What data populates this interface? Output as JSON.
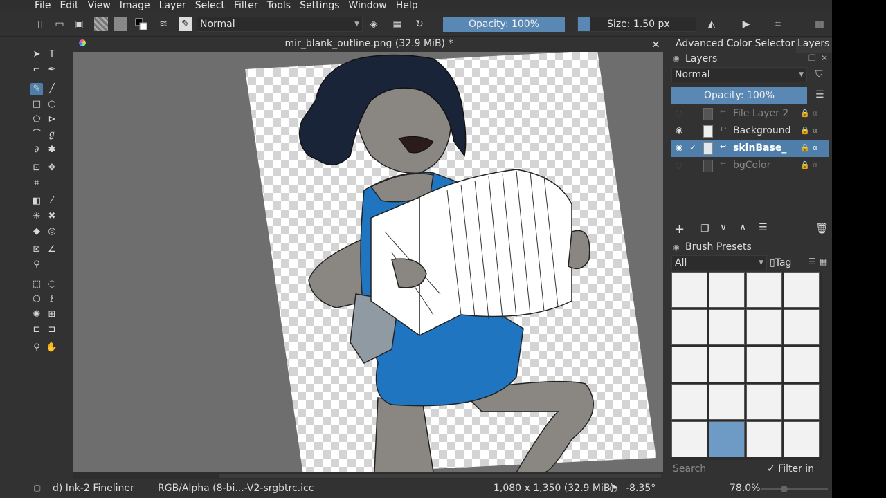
{
  "menu": [
    "File",
    "Edit",
    "View",
    "Image",
    "Layer",
    "Select",
    "Filter",
    "Tools",
    "Settings",
    "Window",
    "Help"
  ],
  "toolbar": {
    "blend_mode": "Normal",
    "opacity": "Opacity: 100%",
    "size": "Size: 1.50 px"
  },
  "document": {
    "title": "mir_blank_outline.png (32.9 MiB) *",
    "close": "×"
  },
  "docker": {
    "tabs": [
      "Advanced Color Selector",
      "Layers"
    ],
    "layers_title": "Layers",
    "blend_mode": "Normal",
    "opacity": "Opacity:  100%",
    "layers": [
      {
        "name": "File Layer 2",
        "visible": false,
        "selected": false
      },
      {
        "name": "Background",
        "visible": true,
        "selected": false
      },
      {
        "name": "skinBase_",
        "visible": true,
        "selected": true
      },
      {
        "name": "bgColor",
        "visible": false,
        "selected": false
      }
    ],
    "brush_presets_title": "Brush Presets",
    "preset_filter": "All",
    "tag_label": "Tag",
    "search_placeholder": "Search",
    "filter_in_tag": "Filter in Tag"
  },
  "status": {
    "brush": "d) Ink-2 Fineliner",
    "color_profile": "RGB/Alpha (8-bi...-V2-srgbtrc.icc",
    "dimensions": "1,080 x 1,350 (32.9 MiB)",
    "rotation": "-8.35°",
    "zoom": "78.0%"
  },
  "colors": {
    "accent": "#4f7eab",
    "background": "#323232",
    "canvas_bg": "#6e6e6e",
    "dress": "#1f75c0",
    "hair": "#1a2438",
    "skin": "#8a8782"
  }
}
